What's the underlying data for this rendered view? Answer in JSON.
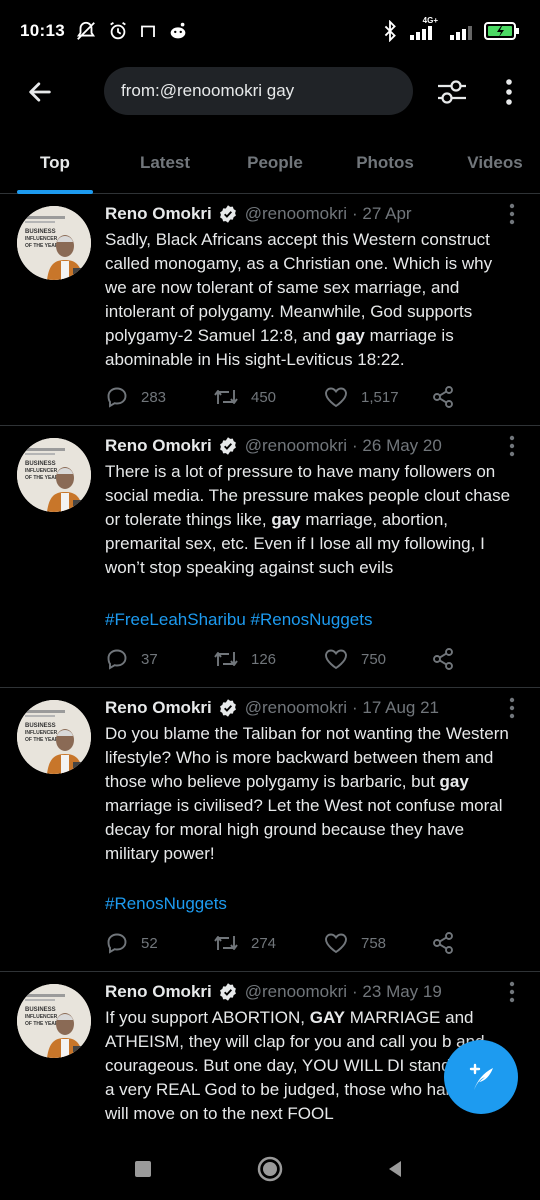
{
  "status_bar": {
    "time": "10:13",
    "left_icons": [
      "mute-notifications-icon",
      "alarm-icon",
      "cast-icon",
      "reddit-icon"
    ],
    "right_icons": [
      "bluetooth-icon",
      "signal-4g-icon",
      "signal-icon",
      "battery-icon"
    ],
    "network_label": "4G+"
  },
  "header": {
    "search_query": "from:@renoomokri gay"
  },
  "tabs": [
    {
      "label": "Top",
      "active": true
    },
    {
      "label": "Latest",
      "active": false
    },
    {
      "label": "People",
      "active": false
    },
    {
      "label": "Photos",
      "active": false
    },
    {
      "label": "Videos",
      "active": false
    }
  ],
  "tweets": [
    {
      "name": "Reno Omokri",
      "handle": "@renoomokri",
      "date": "· 27 Apr",
      "text_parts": [
        "Sadly, Black Africans accept this Western construct called monogamy, as a Christian one. Which is why we are now tolerant of same sex marriage, and intolerant of polygamy. Meanwhile, God supports polygamy-2 Samuel 12:8, and ",
        "gay",
        " marriage is abominable in His sight-Leviticus 18:22."
      ],
      "hashtags": "",
      "replies": "283",
      "retweets": "450",
      "likes": "1,517"
    },
    {
      "name": "Reno Omokri",
      "handle": "@renoomokri",
      "date": "· 26 May 20",
      "text_parts": [
        "There is a lot of pressure to have many followers on social media. The pressure makes people clout chase or tolerate things like, ",
        "gay",
        " marriage, abortion, premarital sex, etc. Even if I lose all my following, I won’t stop speaking against such evils"
      ],
      "hashtags": "#FreeLeahSharibu #RenosNuggets",
      "replies": "37",
      "retweets": "126",
      "likes": "750"
    },
    {
      "name": "Reno Omokri",
      "handle": "@renoomokri",
      "date": "· 17 Aug 21",
      "text_parts": [
        "Do you blame the Taliban for not wanting the Western lifestyle? Who is more backward between them and those who believe polygamy is barbaric, but ",
        "gay",
        " marriage is civilised? Let the West not confuse moral decay for moral high ground because they have military power!"
      ],
      "hashtags": "#RenosNuggets",
      "replies": "52",
      "retweets": "274",
      "likes": "758"
    },
    {
      "name": "Reno Omokri",
      "handle": "@renoomokri",
      "date": "· 23 May 19",
      "text_parts": [
        "If you support ABORTION, ",
        "GAY",
        " MARRIAGE and ATHEISM, they will clap for you and call you b and courageous. But one day, YOU WILL DI stand before a very REAL God to be judged, those who hailed you will move on to the next FOOL"
      ],
      "hashtags": "",
      "replies": "",
      "retweets": "",
      "likes": ""
    }
  ],
  "avatar_lettering": [
    "BUSINESS",
    "INFLUENCER",
    "OF THE YEAR"
  ],
  "colors": {
    "background": "#000000",
    "accent": "#1d9bf0",
    "secondary_text": "#71767b",
    "primary_text": "#e7e9ea",
    "divider": "#2f3336"
  }
}
